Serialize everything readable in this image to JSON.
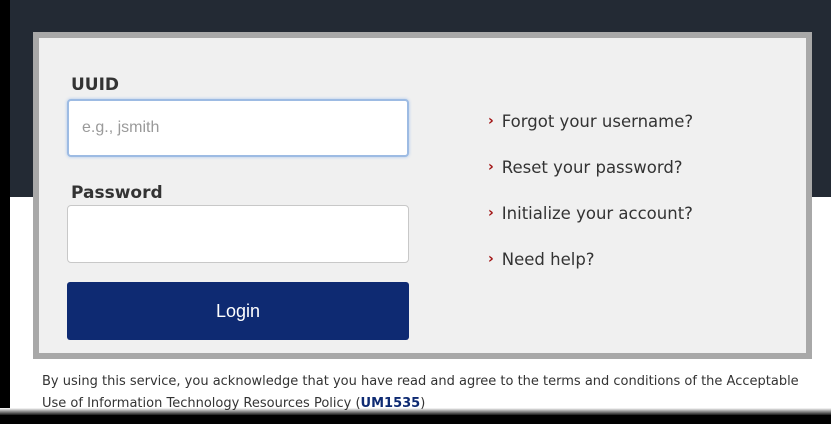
{
  "form": {
    "uuid_label": "UUID",
    "uuid_placeholder": "e.g., jsmith",
    "password_label": "Password",
    "login_label": "Login"
  },
  "links": [
    {
      "label": "Forgot your username?"
    },
    {
      "label": "Reset your password?"
    },
    {
      "label": "Initialize your account?"
    },
    {
      "label": "Need help?"
    }
  ],
  "chevron_glyph": "›",
  "footer": {
    "text_before": "By using this service, you acknowledge that you have read and agree to the terms and conditions of the Acceptable Use of Information Technology Resources Policy (",
    "policy_link": "UM1535",
    "text_after": ")"
  },
  "colors": {
    "header_bg": "#232a34",
    "card_bg": "#f0f0f0",
    "card_border": "#a8a8a8",
    "button_bg": "#0e2a72",
    "chevron": "#a01010"
  }
}
